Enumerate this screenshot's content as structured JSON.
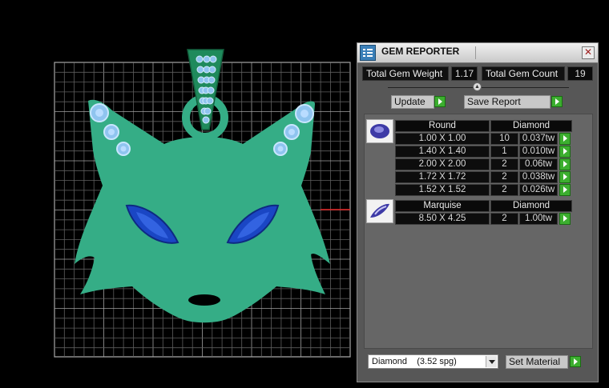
{
  "panel": {
    "title": "GEM REPORTER",
    "close_glyph": "✕",
    "total_weight_label": "Total Gem Weight",
    "total_weight_value": "1.17",
    "total_count_label": "Total Gem Count",
    "total_count_value": "19",
    "update_label": "Update",
    "save_report_label": "Save Report",
    "set_material_label": "Set Material",
    "material_select_value": "Diamond    (3.52 spg)"
  },
  "gem_groups": [
    {
      "cut": "Round",
      "material": "Diamond",
      "thumbnail_icon": "round-gem-icon",
      "rows": [
        {
          "size": "1.00 X 1.00",
          "count": "10",
          "weight": "0.037tw"
        },
        {
          "size": "1.40 X 1.40",
          "count": "1",
          "weight": "0.010tw"
        },
        {
          "size": "2.00 X 2.00",
          "count": "2",
          "weight": "0.06tw"
        },
        {
          "size": "1.72 X 1.72",
          "count": "2",
          "weight": "0.038tw"
        },
        {
          "size": "1.52 X 1.52",
          "count": "2",
          "weight": "0.026tw"
        }
      ]
    },
    {
      "cut": "Marquise",
      "material": "Diamond",
      "thumbnail_icon": "marquise-gem-icon",
      "rows": [
        {
          "size": "8.50 X 4.25",
          "count": "2",
          "weight": "1.00tw"
        }
      ]
    }
  ],
  "colors": {
    "pendant": "#35ad86",
    "pendant_bail": "#1f8a5c",
    "gem_round": "#8fc4ef",
    "gem_marquise": "#1a46c4",
    "grid": "#8f8f8f",
    "axis": "#e02020",
    "accent_button": "#3cae2f"
  }
}
